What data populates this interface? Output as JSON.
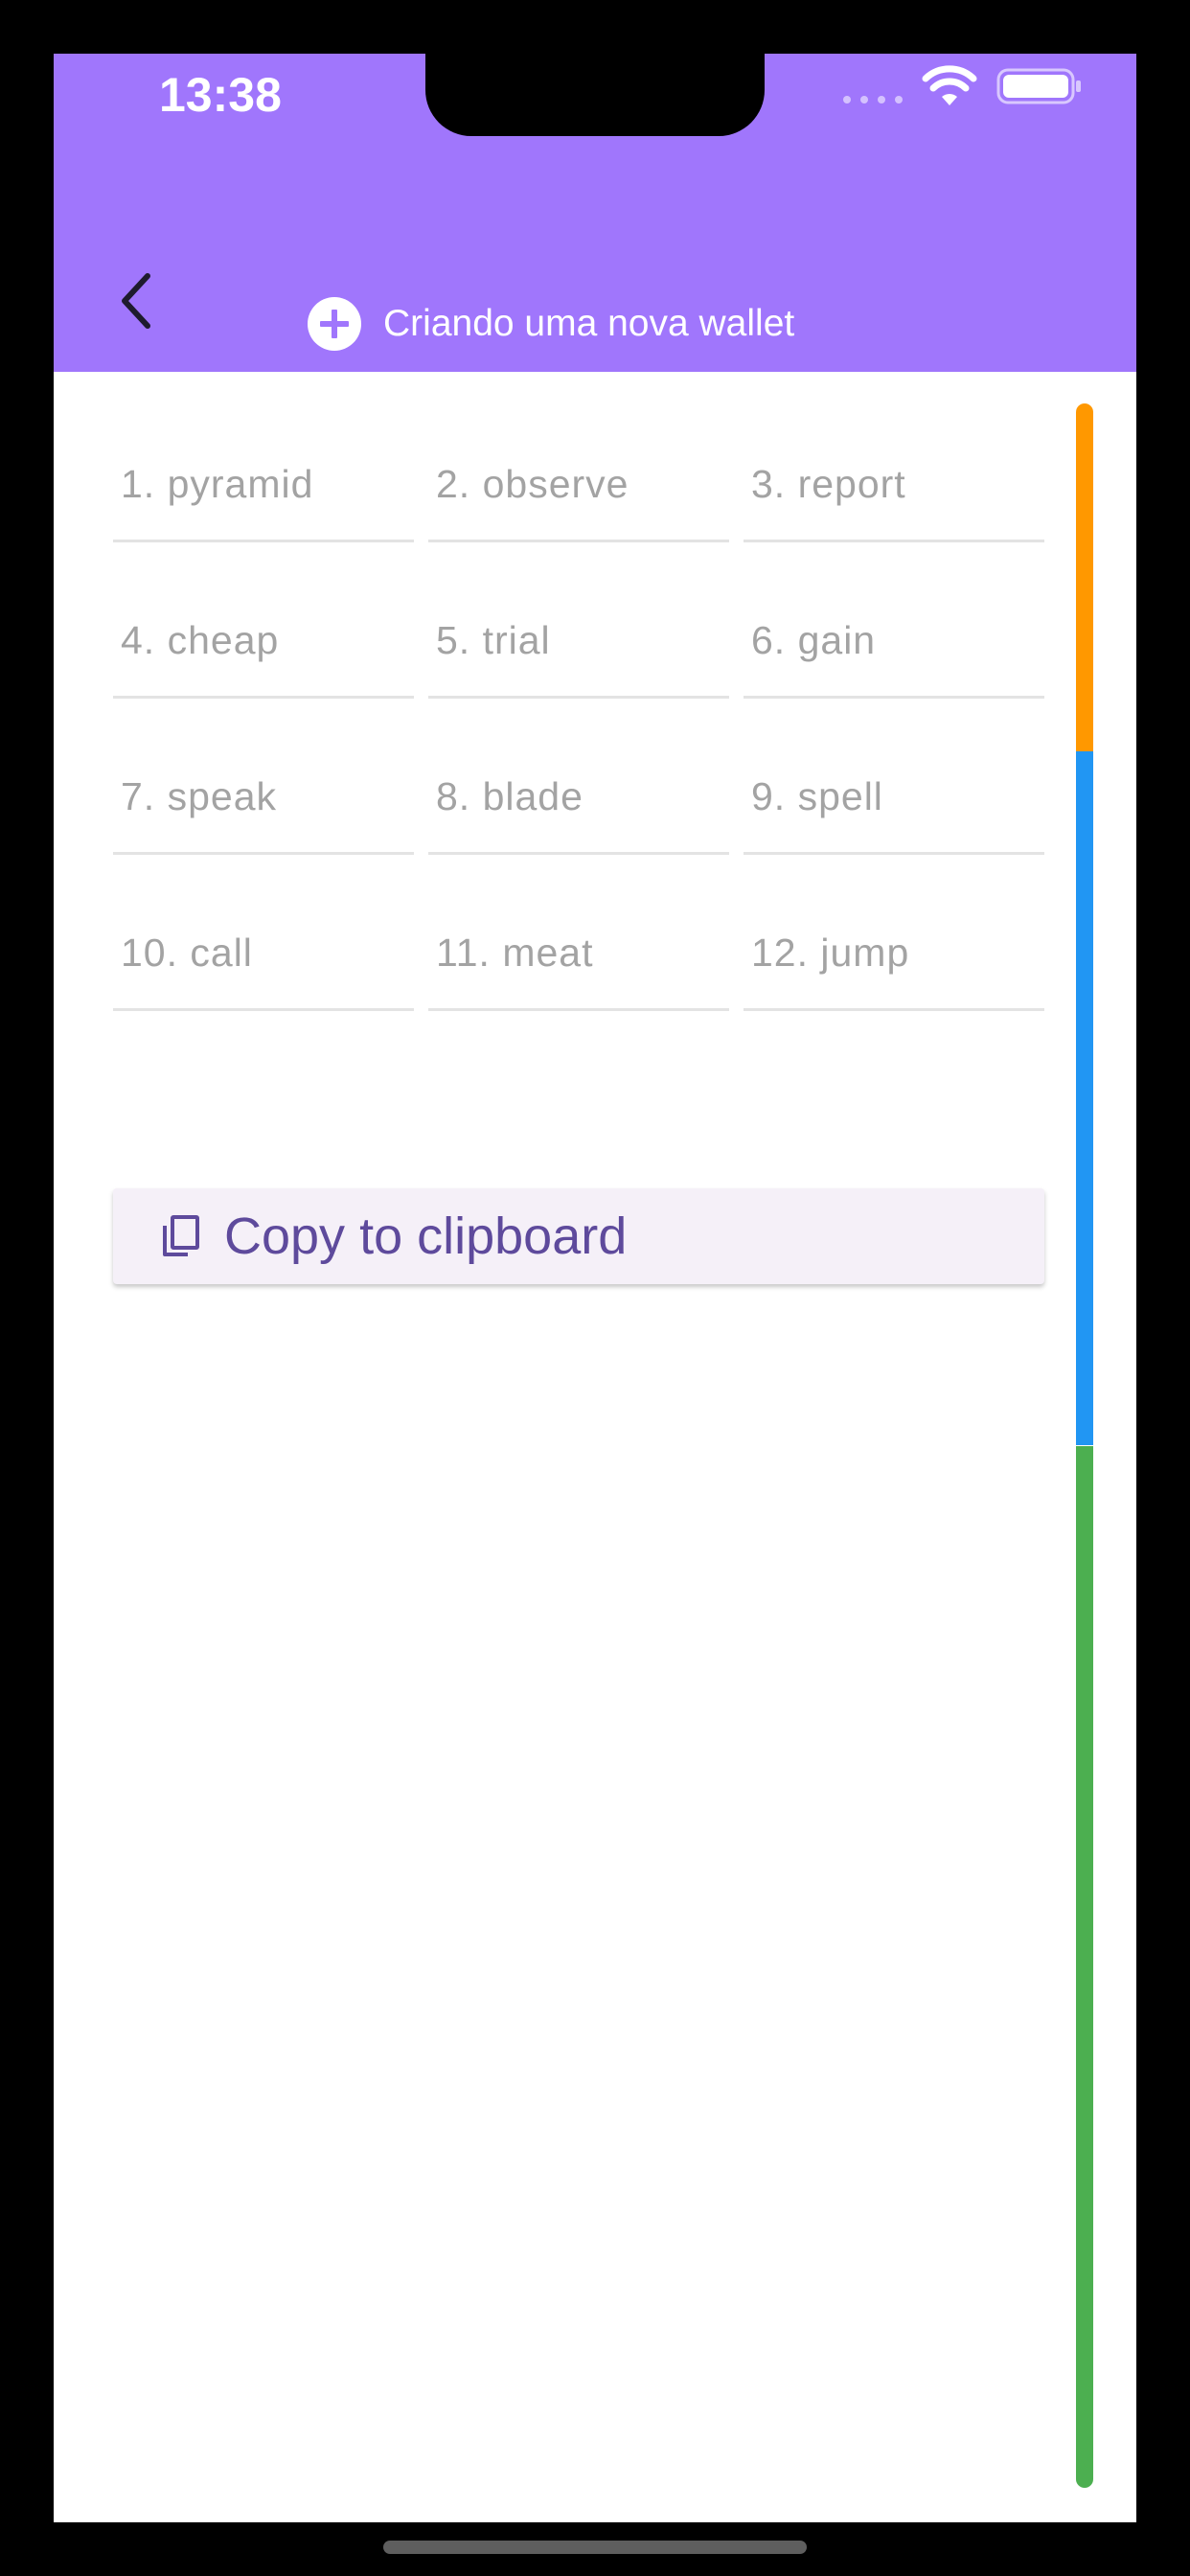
{
  "status_bar": {
    "time": "13:38",
    "icons": [
      "cellular-dots-icon",
      "wifi-icon",
      "battery-icon"
    ]
  },
  "app_bar": {
    "back_icon": "chevron-left-icon",
    "title_icon": "add-circle-icon",
    "title": "Criando uma nova wallet"
  },
  "mnemonic": {
    "words": [
      "1. pyramid",
      "2. observe",
      "3. report",
      "4. cheap",
      "5. trial",
      "6. gain",
      "7. speak",
      "8. blade",
      "9. spell",
      "10. call",
      "11. meat",
      "12. jump"
    ]
  },
  "copy_button": {
    "icon": "copy-icon",
    "label": "Copy to clipboard"
  },
  "strength_indicator": {
    "segments": [
      {
        "color": "#ff9800",
        "fraction": 0.167
      },
      {
        "color": "#2196f3",
        "fraction": 0.333
      },
      {
        "color": "#4caf50",
        "fraction": 0.5
      }
    ]
  },
  "colors": {
    "app_bar": "#a076fc",
    "accent_text": "#5e4a9c",
    "word_text": "#a3a3a3"
  }
}
